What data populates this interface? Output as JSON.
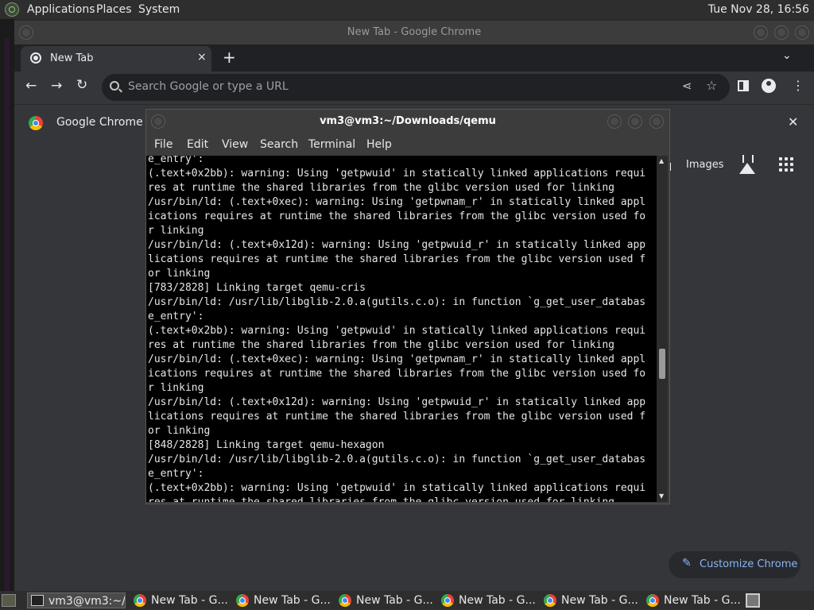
{
  "topbar": {
    "menus": [
      "Applications",
      "Places",
      "System"
    ],
    "clock": "Tue Nov 28, 16:56"
  },
  "chrome": {
    "window_title": "New Tab - Google Chrome",
    "tab_label": "New Tab",
    "tab_close": "×",
    "new_tab": "+",
    "tab_search": "⌄",
    "back": "←",
    "forward": "→",
    "reload": "↻",
    "omnibox_placeholder": "Search Google or type a URL",
    "share": "⋖",
    "bookmark": "☆",
    "menu": "⋮",
    "infobar_text": "Google Chrome is",
    "infobar_close": "✕",
    "gmail_link": "il",
    "images_link": "Images",
    "customize_label": "Customize Chrome",
    "customize_icon": "✎"
  },
  "terminal": {
    "title": "vm3@vm3:~/Downloads/qemu",
    "menus": [
      "File",
      "Edit",
      "View",
      "Search",
      "Terminal",
      "Help"
    ],
    "lines": [
      "e_entry':",
      "(.text+0x2bb): warning: Using 'getpwuid' in statically linked applications requi",
      "res at runtime the shared libraries from the glibc version used for linking",
      "/usr/bin/ld: (.text+0xec): warning: Using 'getpwnam_r' in statically linked appl",
      "ications requires at runtime the shared libraries from the glibc version used fo",
      "r linking",
      "/usr/bin/ld: (.text+0x12d): warning: Using 'getpwuid_r' in statically linked app",
      "lications requires at runtime the shared libraries from the glibc version used f",
      "or linking",
      "[783/2828] Linking target qemu-cris",
      "/usr/bin/ld: /usr/lib/libglib-2.0.a(gutils.c.o): in function `g_get_user_databas",
      "e_entry':",
      "(.text+0x2bb): warning: Using 'getpwuid' in statically linked applications requi",
      "res at runtime the shared libraries from the glibc version used for linking",
      "/usr/bin/ld: (.text+0xec): warning: Using 'getpwnam_r' in statically linked appl",
      "ications requires at runtime the shared libraries from the glibc version used fo",
      "r linking",
      "/usr/bin/ld: (.text+0x12d): warning: Using 'getpwuid_r' in statically linked app",
      "lications requires at runtime the shared libraries from the glibc version used f",
      "or linking",
      "[848/2828] Linking target qemu-hexagon",
      "/usr/bin/ld: /usr/lib/libglib-2.0.a(gutils.c.o): in function `g_get_user_databas",
      "e_entry':",
      "(.text+0x2bb): warning: Using 'getpwuid' in statically linked applications requi",
      "res at runtime the shared libraries from the glibc version used for linking"
    ]
  },
  "taskbar": {
    "items": [
      {
        "label": "vm3@vm3:~/...",
        "kind": "terminal",
        "active": true
      },
      {
        "label": "New Tab - G...",
        "kind": "chrome"
      },
      {
        "label": "New Tab - G...",
        "kind": "chrome"
      },
      {
        "label": "New Tab - G...",
        "kind": "chrome"
      },
      {
        "label": "New Tab - G...",
        "kind": "chrome"
      },
      {
        "label": "New Tab - G...",
        "kind": "chrome"
      },
      {
        "label": "New Tab - G...",
        "kind": "chrome"
      }
    ]
  }
}
